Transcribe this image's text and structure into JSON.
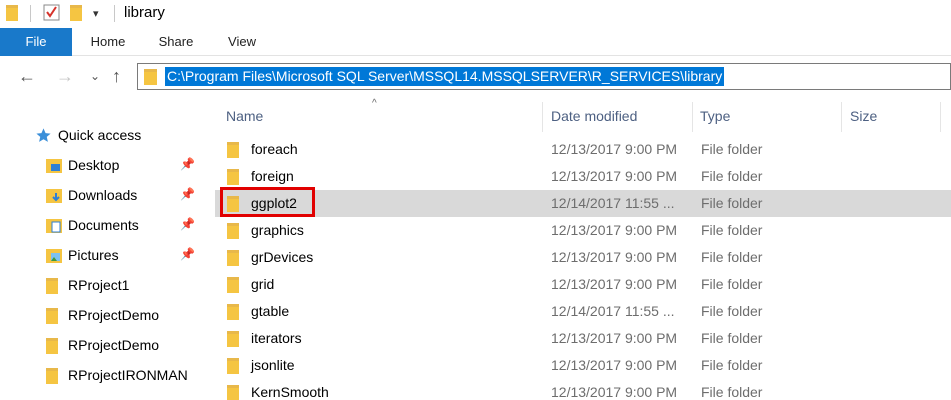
{
  "window": {
    "title": "library"
  },
  "ribbon": {
    "tabs": [
      {
        "label": "File",
        "active": true
      },
      {
        "label": "Home"
      },
      {
        "label": "Share"
      },
      {
        "label": "View"
      }
    ]
  },
  "address": {
    "path": "C:\\Program Files\\Microsoft SQL Server\\MSSQL14.MSSQLSERVER\\R_SERVICES\\library",
    "selected": true
  },
  "columns": {
    "name": "Name",
    "date": "Date modified",
    "type": "Type",
    "size": "Size"
  },
  "nav_pane": {
    "quick_access": "Quick access",
    "items": [
      {
        "label": "Desktop",
        "icon": "desktop-folder-icon",
        "pinned": true
      },
      {
        "label": "Downloads",
        "icon": "downloads-folder-icon",
        "pinned": true
      },
      {
        "label": "Documents",
        "icon": "documents-folder-icon",
        "pinned": true
      },
      {
        "label": "Pictures",
        "icon": "pictures-folder-icon",
        "pinned": true
      },
      {
        "label": "RProject1",
        "icon": "folder-icon",
        "pinned": false
      },
      {
        "label": "RProjectDemo",
        "icon": "folder-icon",
        "pinned": false
      },
      {
        "label": "RProjectDemo",
        "icon": "folder-icon",
        "pinned": false
      },
      {
        "label": "RProjectIRONMAN",
        "icon": "folder-icon",
        "pinned": false
      }
    ]
  },
  "files": [
    {
      "name": "foreach",
      "date": "12/13/2017 9:00 PM",
      "type": "File folder"
    },
    {
      "name": "foreign",
      "date": "12/13/2017 9:00 PM",
      "type": "File folder"
    },
    {
      "name": "ggplot2",
      "date": "12/14/2017 11:55 ...",
      "type": "File folder",
      "selected": true
    },
    {
      "name": "graphics",
      "date": "12/13/2017 9:00 PM",
      "type": "File folder"
    },
    {
      "name": "grDevices",
      "date": "12/13/2017 9:00 PM",
      "type": "File folder"
    },
    {
      "name": "grid",
      "date": "12/13/2017 9:00 PM",
      "type": "File folder"
    },
    {
      "name": "gtable",
      "date": "12/14/2017 11:55 ...",
      "type": "File folder"
    },
    {
      "name": "iterators",
      "date": "12/13/2017 9:00 PM",
      "type": "File folder"
    },
    {
      "name": "jsonlite",
      "date": "12/13/2017 9:00 PM",
      "type": "File folder"
    },
    {
      "name": "KernSmooth",
      "date": "12/13/2017 9:00 PM",
      "type": "File folder"
    }
  ],
  "colors": {
    "accent": "#0078d7",
    "file_tab": "#1979ca",
    "selection": "#d9d9d9",
    "highlight": "#e10000",
    "folder": "#f5c542"
  }
}
